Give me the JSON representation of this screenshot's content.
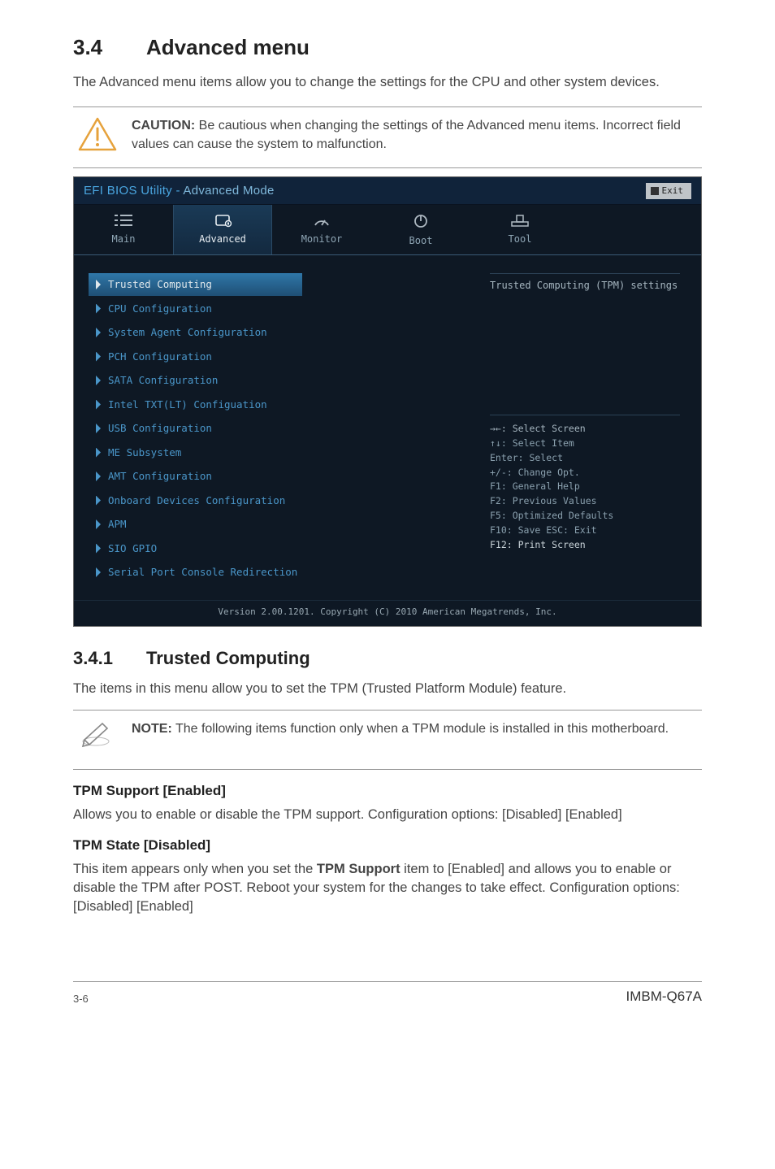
{
  "section": {
    "number": "3.4",
    "title": "Advanced menu",
    "intro": "The Advanced menu items allow you to change the settings for the CPU and other system devices."
  },
  "caution": {
    "label": "CAUTION:",
    "text": "Be cautious when changing the settings of the Advanced menu items. Incorrect field values can cause the system to malfunction."
  },
  "bios": {
    "title_left": "EFI BIOS Utility -",
    "title_right": "Advanced Mode",
    "exit_label": "Exit",
    "tabs": [
      {
        "label": "Main"
      },
      {
        "label": "Advanced"
      },
      {
        "label": "Monitor"
      },
      {
        "label": "Boot"
      },
      {
        "label": "Tool"
      }
    ],
    "menu": [
      {
        "label": "Trusted Computing",
        "selected": true
      },
      {
        "label": "CPU Configuration"
      },
      {
        "label": "System Agent Configuration"
      },
      {
        "label": "PCH Configuration"
      },
      {
        "label": "SATA Configuration"
      },
      {
        "label": "Intel TXT(LT) Configuation"
      },
      {
        "label": "USB Configuration"
      },
      {
        "label": "ME Subsystem"
      },
      {
        "label": "AMT Configuration"
      },
      {
        "label": "Onboard Devices Configuration"
      },
      {
        "label": "APM"
      },
      {
        "label": "SIO GPIO"
      },
      {
        "label": "Serial Port Console Redirection"
      }
    ],
    "right_header": "Trusted Computing (TPM) settings",
    "help": {
      "l1": "→←: Select Screen",
      "l2": "↑↓: Select Item",
      "l3": "Enter: Select",
      "l4": "+/-: Change Opt.",
      "l5": "F1: General Help",
      "l6": "F2: Previous Values",
      "l7": "F5: Optimized Defaults",
      "l8": "F10: Save  ESC: Exit",
      "l9": "F12: Print Screen"
    },
    "footer": "Version 2.00.1201. Copyright (C) 2010 American Megatrends, Inc."
  },
  "subsection": {
    "number": "3.4.1",
    "title": "Trusted Computing",
    "intro": "The items in this menu allow you to set the TPM (Trusted Platform Module) feature."
  },
  "note": {
    "label": "NOTE:",
    "text": "The following items function only when a TPM module is installed in this motherboard."
  },
  "tpm_support": {
    "heading": "TPM Support [Enabled]",
    "body": "Allows you to enable or disable the TPM support. Configuration options: [Disabled] [Enabled]"
  },
  "tpm_state": {
    "heading": "TPM State [Disabled]",
    "body_pre": "This item appears only when you set the ",
    "body_bold": "TPM Support",
    "body_post": " item to [Enabled] and allows you to enable or disable the TPM after POST. Reboot your system for the changes to take effect. Configuration options: [Disabled] [Enabled]"
  },
  "footer": {
    "page": "3-6",
    "product": "IMBM-Q67A"
  }
}
